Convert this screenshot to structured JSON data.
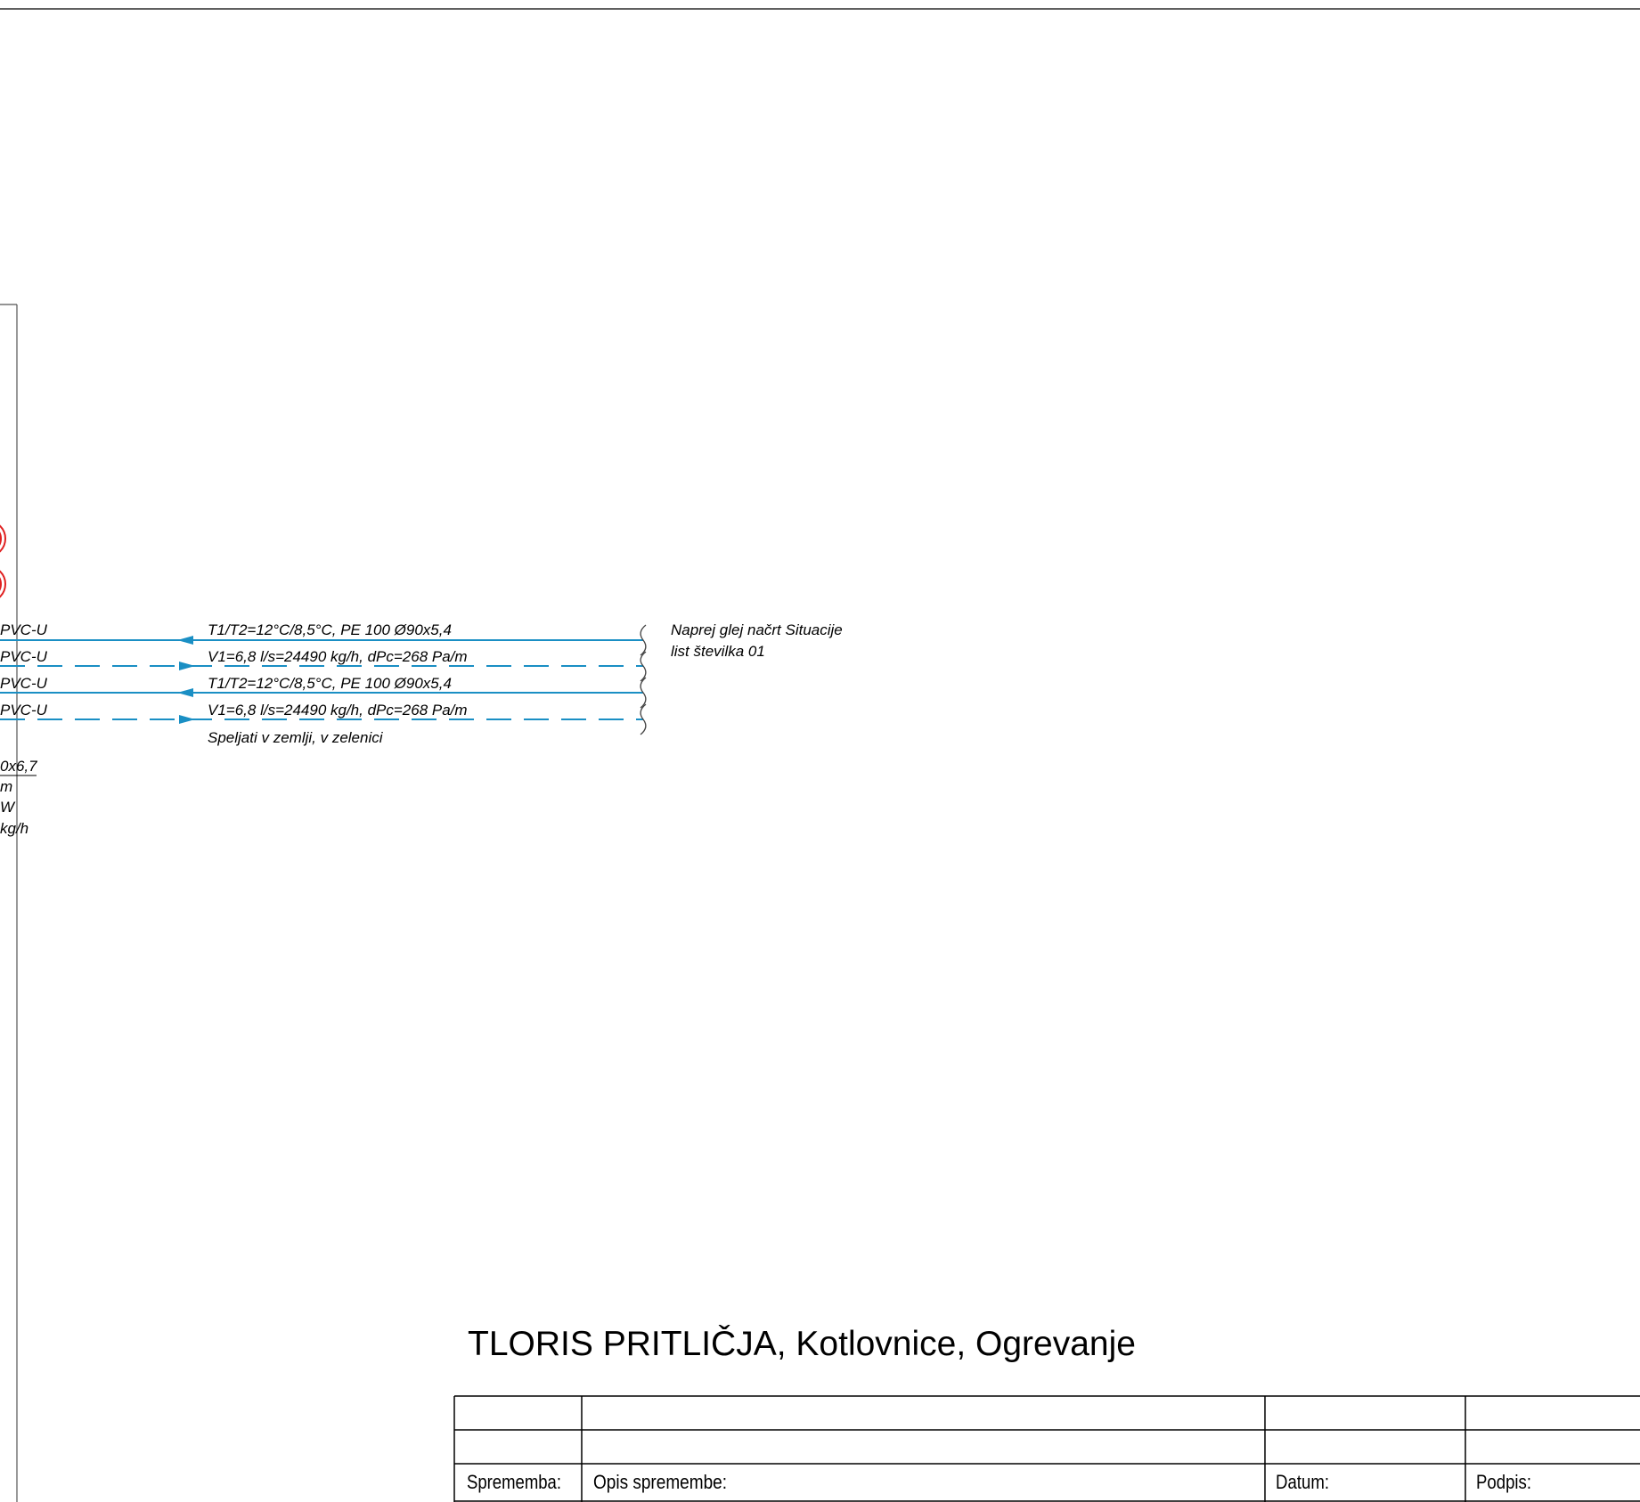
{
  "pipe_labels": {
    "left_fragments": [
      "PVC-U",
      "PVC-U",
      "PVC-U",
      "PVC-U"
    ],
    "row1": "T1/T2=12°C/8,5°C, PE 100 Ø90x5,4",
    "row2": "V1=6,8 l/s=24490 kg/h, dPc=268 Pa/m",
    "row3": "T1/T2=12°C/8,5°C, PE 100 Ø90x5,4",
    "row4": "V1=6,8 l/s=24490 kg/h, dPc=268 Pa/m",
    "row5": "Speljati v zemlji, v zelenici"
  },
  "left_spec_fragments": [
    "0x6,7",
    "m",
    "W",
    "kg/h"
  ],
  "note": {
    "line1": "Naprej glej načrt Situacije",
    "line2": "list številka 01"
  },
  "sheet_title": "TLORIS PRITLIČJA, Kotlovnice, Ogrevanje",
  "revision_table": {
    "headers": {
      "change": "Sprememba:",
      "description": "Opis spremembe:",
      "date": "Datum:",
      "signature": "Podpis:"
    }
  },
  "colors": {
    "pipe": "#1a8fc4",
    "symbol": "#e02020",
    "line": "#000000"
  }
}
